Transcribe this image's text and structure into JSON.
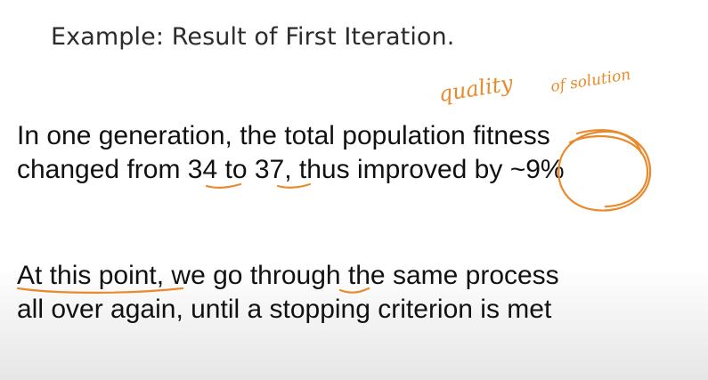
{
  "slide": {
    "title": "Example: Result of First Iteration.",
    "paragraph1": {
      "line1": "In one generation, the total population fitness",
      "line2_before": "changed from ",
      "value_from": "34",
      "line2_mid": " to ",
      "value_to": "37",
      "line2_after": ", thus improved by ",
      "improvement": "~9%"
    },
    "paragraph2": {
      "line1_a": "At this point",
      "line1_b": ", we go through the same process",
      "line2": "all over again, until a stopping criterion is met"
    }
  },
  "annotations": {
    "ink_color": "#e98a2c",
    "handwritten_word1": "quality",
    "handwritten_word2": "of solution"
  }
}
